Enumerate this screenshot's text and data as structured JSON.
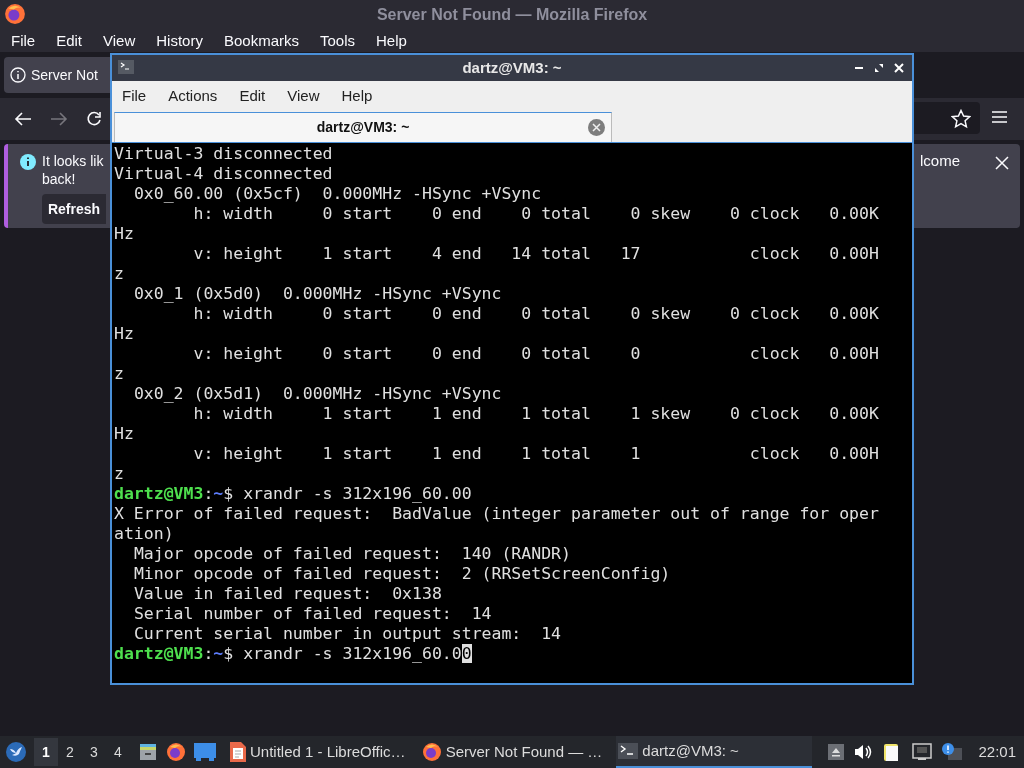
{
  "browser": {
    "title": "Server Not Found — Mozilla Firefox",
    "menu": [
      "File",
      "Edit",
      "View",
      "History",
      "Bookmarks",
      "Tools",
      "Help"
    ],
    "tab": {
      "label": "Server Not"
    },
    "notice": {
      "text_left": "It looks lik",
      "text_left_2": "back!",
      "text_right": "lcome",
      "button": "Refresh"
    }
  },
  "terminal": {
    "title": "dartz@VM3: ~",
    "menu": [
      "File",
      "Actions",
      "Edit",
      "View",
      "Help"
    ],
    "tabs": [
      {
        "label": "dartz@VM3: ~",
        "selected": true
      }
    ],
    "lines": [
      {
        "kind": "output",
        "text": "Virtual-3 disconnected"
      },
      {
        "kind": "output",
        "text": "Virtual-4 disconnected"
      },
      {
        "kind": "output",
        "text": "  0x0_60.00 (0x5cf)  0.000MHz -HSync +VSync"
      },
      {
        "kind": "output",
        "text": "        h: width     0 start    0 end    0 total    0 skew    0 clock   0.00KHz"
      },
      {
        "kind": "output",
        "text": "        v: height    1 start    4 end   14 total   17           clock   0.00Hz"
      },
      {
        "kind": "output",
        "text": "  0x0_1 (0x5d0)  0.000MHz -HSync +VSync"
      },
      {
        "kind": "output",
        "text": "        h: width     0 start    0 end    0 total    0 skew    0 clock   0.00KHz"
      },
      {
        "kind": "output",
        "text": "        v: height    0 start    0 end    0 total    0           clock   0.00Hz"
      },
      {
        "kind": "output",
        "text": "  0x0_2 (0x5d1)  0.000MHz -HSync +VSync"
      },
      {
        "kind": "output",
        "text": "        h: width     1 start    1 end    1 total    1 skew    0 clock   0.00KHz"
      },
      {
        "kind": "output",
        "text": "        v: height    1 start    1 end    1 total    1           clock   0.00Hz"
      },
      {
        "kind": "prompt",
        "user": "dartz@VM3",
        "sep": ":",
        "path": "~",
        "symbol": "$",
        "command": "xrandr -s 312x196_60.00"
      },
      {
        "kind": "output",
        "text": "X Error of failed request:  BadValue (integer parameter out of range for operation)"
      },
      {
        "kind": "output",
        "text": "  Major opcode of failed request:  140 (RANDR)"
      },
      {
        "kind": "output",
        "text": "  Minor opcode of failed request:  2 (RRSetScreenConfig)"
      },
      {
        "kind": "output",
        "text": "  Value in failed request:  0x138"
      },
      {
        "kind": "output",
        "text": "  Serial number of failed request:  14"
      },
      {
        "kind": "output",
        "text": "  Current serial number in output stream:  14"
      },
      {
        "kind": "prompt",
        "user": "dartz@VM3",
        "sep": ":",
        "path": "~",
        "symbol": "$",
        "command": "xrandr -s 312x196_60.0",
        "cursor": "0"
      }
    ]
  },
  "taskbar": {
    "workspaces": [
      {
        "label": "1",
        "selected": true
      },
      {
        "label": "2",
        "selected": false
      },
      {
        "label": "3",
        "selected": false
      },
      {
        "label": "4",
        "selected": false
      }
    ],
    "tasks": [
      {
        "kind": "office",
        "label": "Untitled 1 - LibreOffic…",
        "selected": false
      },
      {
        "kind": "browser",
        "label": "Server Not Found — …",
        "selected": false
      },
      {
        "kind": "terminal",
        "label": "dartz@VM3: ~",
        "selected": true
      }
    ],
    "clock": "22:01"
  }
}
